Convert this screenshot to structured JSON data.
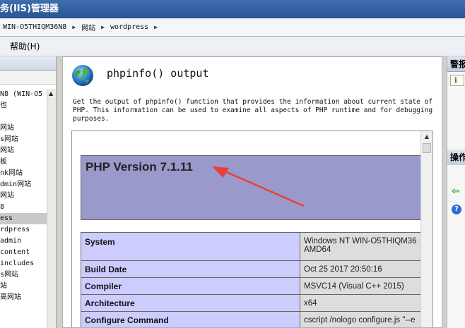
{
  "window": {
    "title": "务(IIS)管理器"
  },
  "address": {
    "crumbs": [
      "WIN-O5THIQM36N8",
      "网站",
      "wordpress"
    ]
  },
  "menu": {
    "help_label": "帮助(H)"
  },
  "left_panel": {
    "tree": [
      "N8 (WIN-O5",
      "也",
      "",
      "网站",
      "s网站",
      "网站",
      "板",
      "nk网站",
      "dmin网站",
      "网站",
      "8",
      "ess",
      "rdpress",
      "admin",
      "content",
      "includes",
      "s网站",
      "站",
      "高网站"
    ],
    "selected_index": 11
  },
  "feature": {
    "title": "phpinfo() output",
    "description": "Get the output of phpinfo() function that provides the information about current state of PHP. This information can be used to examine all aspects of PHP runtime and for debugging purposes."
  },
  "phpinfo": {
    "version": "PHP Version 7.1.11",
    "rows": [
      {
        "key": "System",
        "value": "Windows NT WIN-O5THIQM36",
        "value2": "AMD64"
      },
      {
        "key": "Build Date",
        "value": "Oct 25 2017 20:50:16"
      },
      {
        "key": "Compiler",
        "value": "MSVC14 (Visual C++ 2015)"
      },
      {
        "key": "Architecture",
        "value": "x64"
      },
      {
        "key": "Configure Command",
        "value": "cscript /nologo configure.js \"--e"
      }
    ]
  },
  "right_panel": {
    "alerts_label": "警报",
    "actions_label": "操作",
    "info_icon": "i"
  },
  "colors": {
    "php_header": "#9999cc",
    "php_key": "#ccccff",
    "php_value": "#dddddd",
    "annotation_arrow": "#e8413a"
  }
}
